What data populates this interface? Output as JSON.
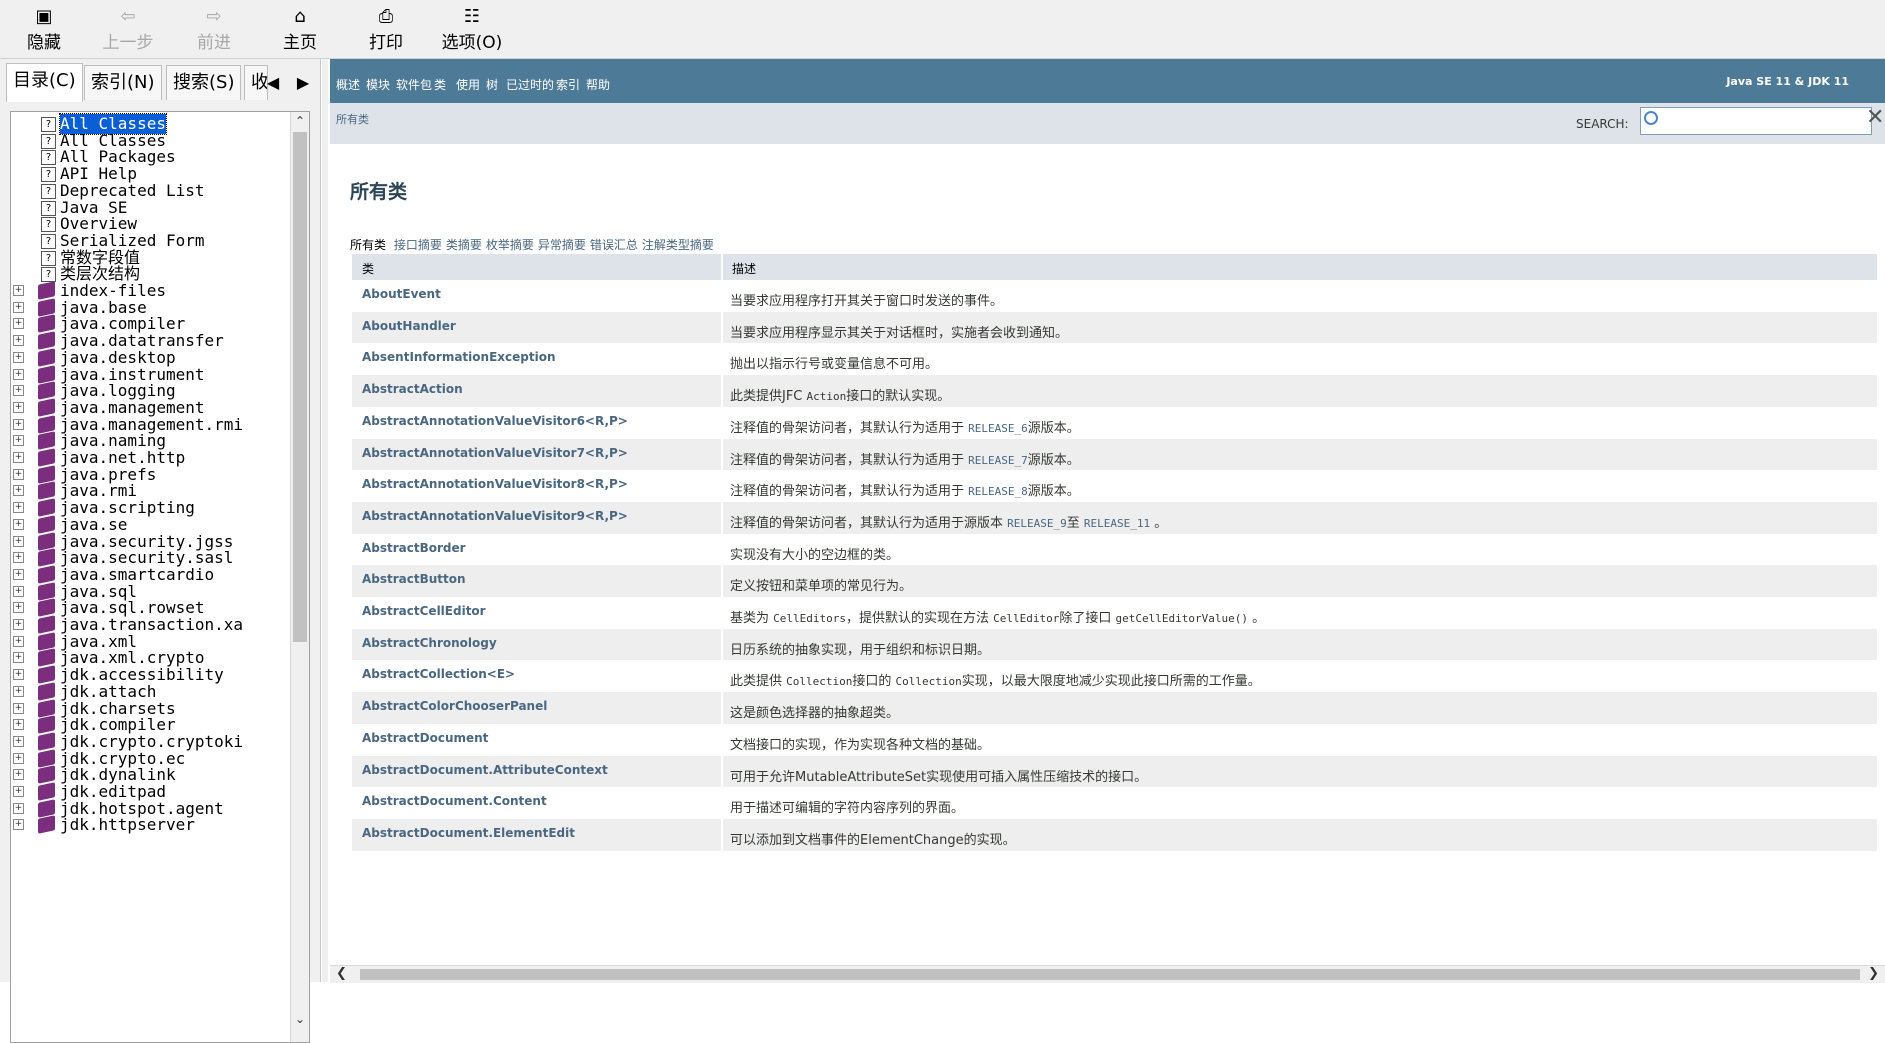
{
  "toolbar": {
    "hide": "隐藏",
    "back": "上一步",
    "forward": "前进",
    "home": "主页",
    "print": "打印",
    "options": "选项(O)"
  },
  "left_tabs": {
    "contents": "目录(C)",
    "index": "索引(N)",
    "search": "搜索(S)",
    "favorites": "收"
  },
  "tree": [
    {
      "label": "All Classes",
      "icon": "help-page",
      "expand": false,
      "selected": true
    },
    {
      "label": "All Classes",
      "icon": "help-page",
      "expand": false
    },
    {
      "label": "All Packages",
      "icon": "help-page",
      "expand": false
    },
    {
      "label": "API Help",
      "icon": "help-page",
      "expand": false
    },
    {
      "label": "Deprecated List",
      "icon": "help-page",
      "expand": false
    },
    {
      "label": "Java SE",
      "icon": "help-page",
      "expand": false
    },
    {
      "label": "Overview",
      "icon": "help-page",
      "expand": false
    },
    {
      "label": "Serialized Form",
      "icon": "help-page",
      "expand": false
    },
    {
      "label": "常数字段值",
      "icon": "help-page",
      "expand": false
    },
    {
      "label": "类层次结构",
      "icon": "help-page",
      "expand": false
    },
    {
      "label": "index-files",
      "icon": "book",
      "expand": true
    },
    {
      "label": "java.base",
      "icon": "book",
      "expand": true
    },
    {
      "label": "java.compiler",
      "icon": "book",
      "expand": true
    },
    {
      "label": "java.datatransfer",
      "icon": "book",
      "expand": true
    },
    {
      "label": "java.desktop",
      "icon": "book",
      "expand": true
    },
    {
      "label": "java.instrument",
      "icon": "book",
      "expand": true
    },
    {
      "label": "java.logging",
      "icon": "book",
      "expand": true
    },
    {
      "label": "java.management",
      "icon": "book",
      "expand": true
    },
    {
      "label": "java.management.rmi",
      "icon": "book",
      "expand": true
    },
    {
      "label": "java.naming",
      "icon": "book",
      "expand": true
    },
    {
      "label": "java.net.http",
      "icon": "book",
      "expand": true
    },
    {
      "label": "java.prefs",
      "icon": "book",
      "expand": true
    },
    {
      "label": "java.rmi",
      "icon": "book",
      "expand": true
    },
    {
      "label": "java.scripting",
      "icon": "book",
      "expand": true
    },
    {
      "label": "java.se",
      "icon": "book",
      "expand": true
    },
    {
      "label": "java.security.jgss",
      "icon": "book",
      "expand": true
    },
    {
      "label": "java.security.sasl",
      "icon": "book",
      "expand": true
    },
    {
      "label": "java.smartcardio",
      "icon": "book",
      "expand": true
    },
    {
      "label": "java.sql",
      "icon": "book",
      "expand": true
    },
    {
      "label": "java.sql.rowset",
      "icon": "book",
      "expand": true
    },
    {
      "label": "java.transaction.xa",
      "icon": "book",
      "expand": true
    },
    {
      "label": "java.xml",
      "icon": "book",
      "expand": true
    },
    {
      "label": "java.xml.crypto",
      "icon": "book",
      "expand": true
    },
    {
      "label": "jdk.accessibility",
      "icon": "book",
      "expand": true
    },
    {
      "label": "jdk.attach",
      "icon": "book",
      "expand": true
    },
    {
      "label": "jdk.charsets",
      "icon": "book",
      "expand": true
    },
    {
      "label": "jdk.compiler",
      "icon": "book",
      "expand": true
    },
    {
      "label": "jdk.crypto.cryptoki",
      "icon": "book",
      "expand": true
    },
    {
      "label": "jdk.crypto.ec",
      "icon": "book",
      "expand": true
    },
    {
      "label": "jdk.dynalink",
      "icon": "book",
      "expand": true
    },
    {
      "label": "jdk.editpad",
      "icon": "book",
      "expand": true
    },
    {
      "label": "jdk.hotspot.agent",
      "icon": "book",
      "expand": true
    },
    {
      "label": "jdk.httpserver",
      "icon": "book",
      "expand": true
    }
  ],
  "navbar": {
    "items": [
      "概述",
      "模块",
      "软件包",
      "类",
      "使用",
      "树",
      "已过时的",
      "索引",
      "帮助"
    ],
    "version": "Java SE 11 & JDK 11"
  },
  "subnav": {
    "all_classes": "所有类",
    "search_label": "SEARCH:",
    "search_value": "",
    "reset": "✕"
  },
  "page": {
    "title": "所有类",
    "tab_current": "所有类",
    "tab_links": [
      "接口摘要",
      "类摘要",
      "枚举摘要",
      "异常摘要",
      "错误汇总",
      "注解类型摘要"
    ]
  },
  "table": {
    "col_class": "类",
    "col_desc": "描述",
    "rows": [
      {
        "cls": "AboutEvent",
        "desc": [
          {
            "t": "当要求应用程序打开其关于窗口时发送的事件。"
          }
        ]
      },
      {
        "cls": "AboutHandler",
        "desc": [
          {
            "t": "当要求应用程序显示其关于对话框时，实施者会收到通知。"
          }
        ]
      },
      {
        "cls": "AbsentInformationException",
        "desc": [
          {
            "t": "抛出以指示行号或变量信息不可用。"
          }
        ]
      },
      {
        "cls": "AbstractAction",
        "desc": [
          {
            "t": "此类提供JFC "
          },
          {
            "t": "Action",
            "k": "code"
          },
          {
            "t": "接口的默认实现。"
          }
        ]
      },
      {
        "cls": "AbstractAnnotationValueVisitor6<R,P>",
        "desc": [
          {
            "t": "注释值的骨架访问者，其默认行为适用于 "
          },
          {
            "t": "RELEASE_6",
            "k": "link"
          },
          {
            "t": "源版本。"
          }
        ]
      },
      {
        "cls": "AbstractAnnotationValueVisitor7<R,P>",
        "desc": [
          {
            "t": "注释值的骨架访问者，其默认行为适用于 "
          },
          {
            "t": "RELEASE_7",
            "k": "link"
          },
          {
            "t": "源版本。"
          }
        ]
      },
      {
        "cls": "AbstractAnnotationValueVisitor8<R,P>",
        "desc": [
          {
            "t": "注释值的骨架访问者，其默认行为适用于 "
          },
          {
            "t": "RELEASE_8",
            "k": "link"
          },
          {
            "t": "源版本。"
          }
        ]
      },
      {
        "cls": "AbstractAnnotationValueVisitor9<R,P>",
        "desc": [
          {
            "t": "注释值的骨架访问者，其默认行为适用于源版本 "
          },
          {
            "t": "RELEASE_9",
            "k": "link"
          },
          {
            "t": "至 "
          },
          {
            "t": "RELEASE_11",
            "k": "link"
          },
          {
            "t": " 。"
          }
        ]
      },
      {
        "cls": "AbstractBorder",
        "desc": [
          {
            "t": "实现没有大小的空边框的类。"
          }
        ]
      },
      {
        "cls": "AbstractButton",
        "desc": [
          {
            "t": "定义按钮和菜单项的常见行为。"
          }
        ]
      },
      {
        "cls": "AbstractCellEditor",
        "desc": [
          {
            "t": "基类为 "
          },
          {
            "t": "CellEditors",
            "k": "code"
          },
          {
            "t": "，提供默认的实现在方法 "
          },
          {
            "t": "CellEditor",
            "k": "code"
          },
          {
            "t": "除了接口 "
          },
          {
            "t": "getCellEditorValue()",
            "k": "code"
          },
          {
            "t": " 。"
          }
        ]
      },
      {
        "cls": "AbstractChronology",
        "desc": [
          {
            "t": "日历系统的抽象实现，用于组织和标识日期。"
          }
        ]
      },
      {
        "cls": "AbstractCollection<E>",
        "desc": [
          {
            "t": "此类提供 "
          },
          {
            "t": "Collection",
            "k": "code"
          },
          {
            "t": "接口的 "
          },
          {
            "t": "Collection",
            "k": "code"
          },
          {
            "t": "实现，以最大限度地减少实现此接口所需的工作量。"
          }
        ]
      },
      {
        "cls": "AbstractColorChooserPanel",
        "desc": [
          {
            "t": "这是颜色选择器的抽象超类。"
          }
        ]
      },
      {
        "cls": "AbstractDocument",
        "desc": [
          {
            "t": "文档接口的实现，作为实现各种文档的基础。"
          }
        ]
      },
      {
        "cls": "AbstractDocument.AttributeContext",
        "desc": [
          {
            "t": "可用于允许MutableAttributeSet实现使用可插入属性压缩技术的接口。"
          }
        ]
      },
      {
        "cls": "AbstractDocument.Content",
        "desc": [
          {
            "t": "用于描述可编辑的字符内容序列的界面。"
          }
        ]
      },
      {
        "cls": "AbstractDocument.ElementEdit",
        "desc": [
          {
            "t": "可以添加到文档事件的ElementChange的实现。"
          }
        ]
      }
    ]
  }
}
